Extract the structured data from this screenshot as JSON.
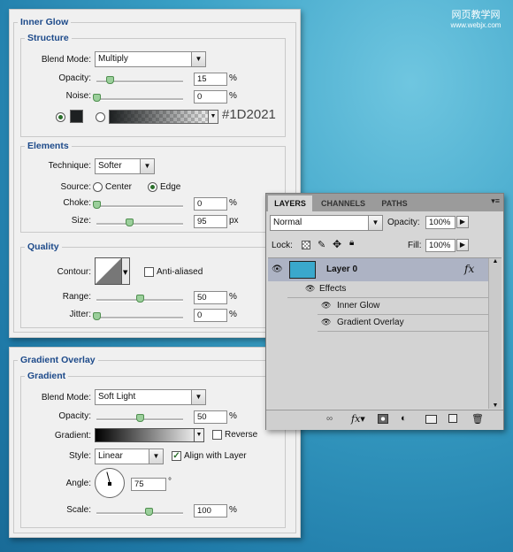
{
  "watermark": {
    "line1": "网页教学网",
    "line2": "www.webjx.com"
  },
  "inner_glow": {
    "title": "Inner Glow",
    "structure": {
      "legend": "Structure",
      "blend_mode_label": "Blend Mode:",
      "blend_mode": "Multiply",
      "opacity_label": "Opacity:",
      "opacity": "15",
      "opacity_unit": "%",
      "opacity_pct": 15,
      "noise_label": "Noise:",
      "noise": "0",
      "noise_unit": "%",
      "noise_pct": 0,
      "color_hex": "#1D2021"
    },
    "elements": {
      "legend": "Elements",
      "technique_label": "Technique:",
      "technique": "Softer",
      "source_label": "Source:",
      "source_center": "Center",
      "source_edge": "Edge",
      "choke_label": "Choke:",
      "choke": "0",
      "choke_unit": "%",
      "choke_pct": 0,
      "size_label": "Size:",
      "size": "95",
      "size_unit": "px",
      "size_pct": 38
    },
    "quality": {
      "legend": "Quality",
      "contour_label": "Contour:",
      "anti_aliased": "Anti-aliased",
      "range_label": "Range:",
      "range": "50",
      "range_unit": "%",
      "range_pct": 50,
      "jitter_label": "Jitter:",
      "jitter": "0",
      "jitter_unit": "%",
      "jitter_pct": 0
    }
  },
  "gradient_overlay": {
    "title": "Gradient Overlay",
    "legend": "Gradient",
    "blend_mode_label": "Blend Mode:",
    "blend_mode": "Soft Light",
    "opacity_label": "Opacity:",
    "opacity": "50",
    "opacity_unit": "%",
    "opacity_pct": 50,
    "gradient_label": "Gradient:",
    "reverse": "Reverse",
    "style_label": "Style:",
    "style": "Linear",
    "align_with_layer": "Align with Layer",
    "angle_label": "Angle:",
    "angle": "75",
    "angle_unit": "°",
    "scale_label": "Scale:",
    "scale": "100",
    "scale_unit": "%",
    "scale_pct": 60
  },
  "layers": {
    "tabs": [
      "LAYERS",
      "CHANNELS",
      "PATHS"
    ],
    "blend_mode": "Normal",
    "opacity_label": "Opacity:",
    "opacity": "100%",
    "lock_label": "Lock:",
    "fill_label": "Fill:",
    "fill": "100%",
    "layer_name": "Layer 0",
    "fx": "fx",
    "effects_label": "Effects",
    "effect1": "Inner Glow",
    "effect2": "Gradient Overlay",
    "thumb_color": "#3aa8cc"
  }
}
